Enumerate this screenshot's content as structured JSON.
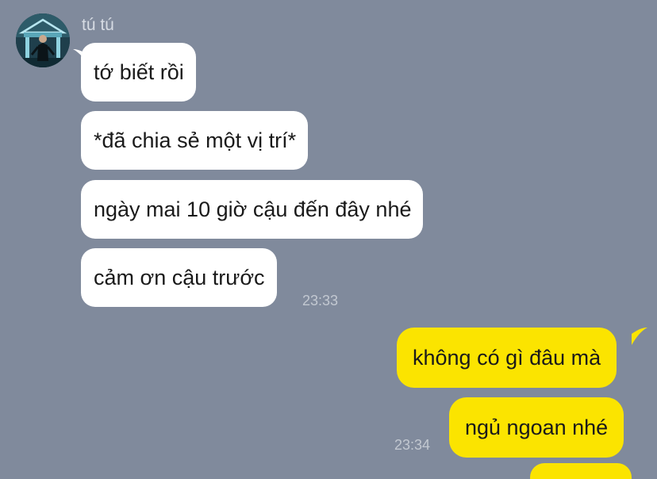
{
  "conversation": {
    "contact": {
      "name": "tú tú",
      "avatar_icon": "avatar-photo"
    },
    "incoming": [
      {
        "text": "tớ biết rồi"
      },
      {
        "text": "*đã chia sẻ một vị trí*"
      },
      {
        "text": "ngày mai 10 giờ cậu đến đây nhé"
      },
      {
        "text": "cảm ơn cậu trước",
        "time": "23:33"
      }
    ],
    "outgoing": [
      {
        "text": "không có gì đâu mà"
      },
      {
        "text": "ngủ ngoan nhé",
        "time": "23:34"
      }
    ]
  },
  "colors": {
    "background": "#808a9c",
    "incoming_bubble": "#ffffff",
    "outgoing_bubble": "#fbe400",
    "timestamp": "#c2c8d1",
    "sender_name": "#d6dbe3"
  }
}
